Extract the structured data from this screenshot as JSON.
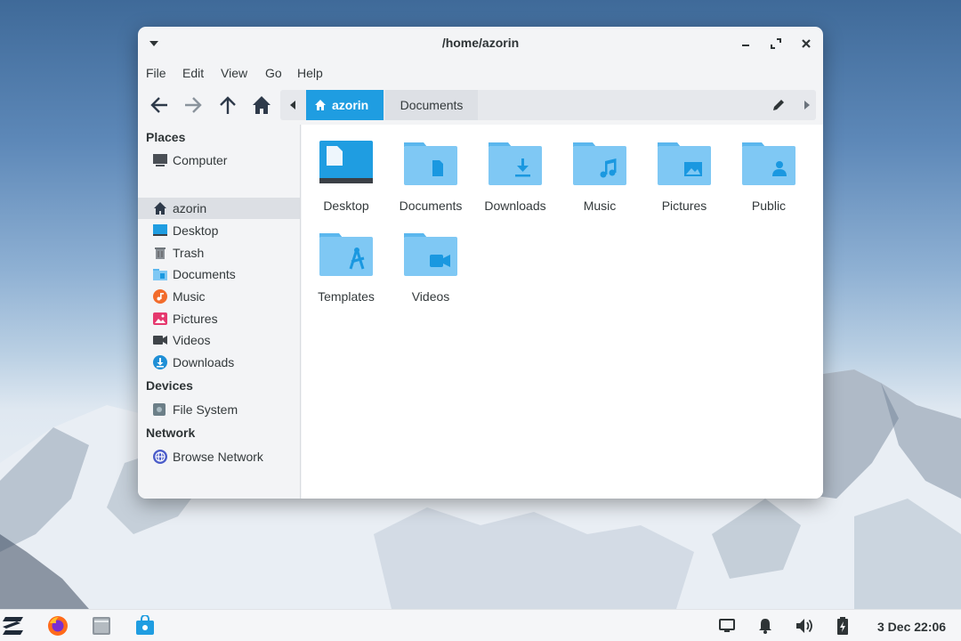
{
  "window": {
    "title": "/home/azorin"
  },
  "menu": [
    "File",
    "Edit",
    "View",
    "Go",
    "Help"
  ],
  "pathbar": {
    "crumbs": [
      "azorin",
      "Documents"
    ]
  },
  "sidebar": {
    "places_header": "Places",
    "places": [
      {
        "label": "Computer",
        "icon": "computer-icon"
      },
      {
        "label": "azorin",
        "icon": "home-icon",
        "selected": true
      },
      {
        "label": "Desktop",
        "icon": "desktop-icon"
      },
      {
        "label": "Trash",
        "icon": "trash-icon"
      },
      {
        "label": "Documents",
        "icon": "documents-folder-icon"
      },
      {
        "label": "Music",
        "icon": "music-icon"
      },
      {
        "label": "Pictures",
        "icon": "pictures-icon"
      },
      {
        "label": "Videos",
        "icon": "videos-icon"
      },
      {
        "label": "Downloads",
        "icon": "downloads-icon"
      }
    ],
    "devices_header": "Devices",
    "devices": [
      {
        "label": "File System",
        "icon": "drive-icon"
      }
    ],
    "network_header": "Network",
    "network": [
      {
        "label": "Browse Network",
        "icon": "network-icon"
      }
    ]
  },
  "content": {
    "items": [
      {
        "label": "Desktop",
        "icon": "desktop-folder-icon"
      },
      {
        "label": "Documents",
        "icon": "documents-folder-icon"
      },
      {
        "label": "Downloads",
        "icon": "downloads-folder-icon"
      },
      {
        "label": "Music",
        "icon": "music-folder-icon"
      },
      {
        "label": "Pictures",
        "icon": "pictures-folder-icon"
      },
      {
        "label": "Public",
        "icon": "public-folder-icon"
      },
      {
        "label": "Templates",
        "icon": "templates-folder-icon"
      },
      {
        "label": "Videos",
        "icon": "videos-folder-icon"
      }
    ]
  },
  "taskbar": {
    "clock": "3 Dec 22:06"
  },
  "colors": {
    "accent": "#1f9de1",
    "folder": "#7fc8f4",
    "folder_tab": "#5bb7ee",
    "folder_glyph": "#1a98e0"
  }
}
